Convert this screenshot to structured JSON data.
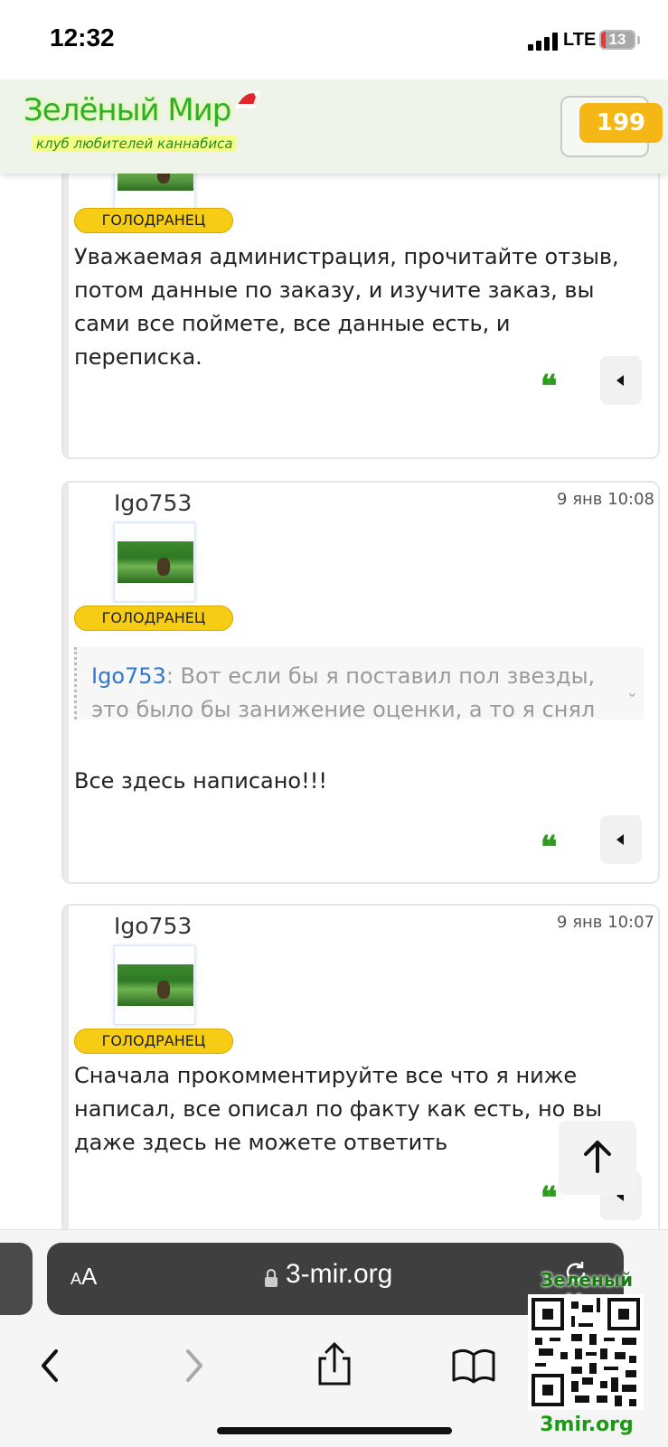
{
  "status_bar": {
    "time": "12:32",
    "network": "LTE",
    "battery": "13"
  },
  "header": {
    "logo_title": "Зелёный Мир",
    "logo_subtitle": "клуб любителей каннабиса",
    "counter": "199"
  },
  "posts": [
    {
      "author": "",
      "date": "",
      "badge": "ГОЛОДРАНЕЦ",
      "text": "Уважаемая администрация, прочитайте отзыв, потом данные по заказу, и изучите заказ, вы сами все поймете, все данные есть, и переписка."
    },
    {
      "author": "Igo753",
      "date": "9 янв 10:08",
      "badge": "ГОЛОДРАНЕЦ",
      "quote_author": "Igo753",
      "quote_text": ": Вот если бы я поставил пол звезды, это было бы занижение оценки, а то я снял",
      "text": "Все здесь написано!!!"
    },
    {
      "author": "Igo753",
      "date": "9 янв 10:07",
      "badge": "ГОЛОДРАНЕЦ",
      "text": "Сначала прокомментируйте все что я ниже написал, все описал по факту как есть, но вы даже здесь не можете ответить"
    }
  ],
  "actions": {
    "quote_glyph": "❝"
  },
  "browser": {
    "aa_small": "A",
    "aa_large": "A",
    "url": "3-mir.org"
  },
  "watermark": {
    "title": "Зеленый Мир",
    "site": "3mir.org"
  }
}
